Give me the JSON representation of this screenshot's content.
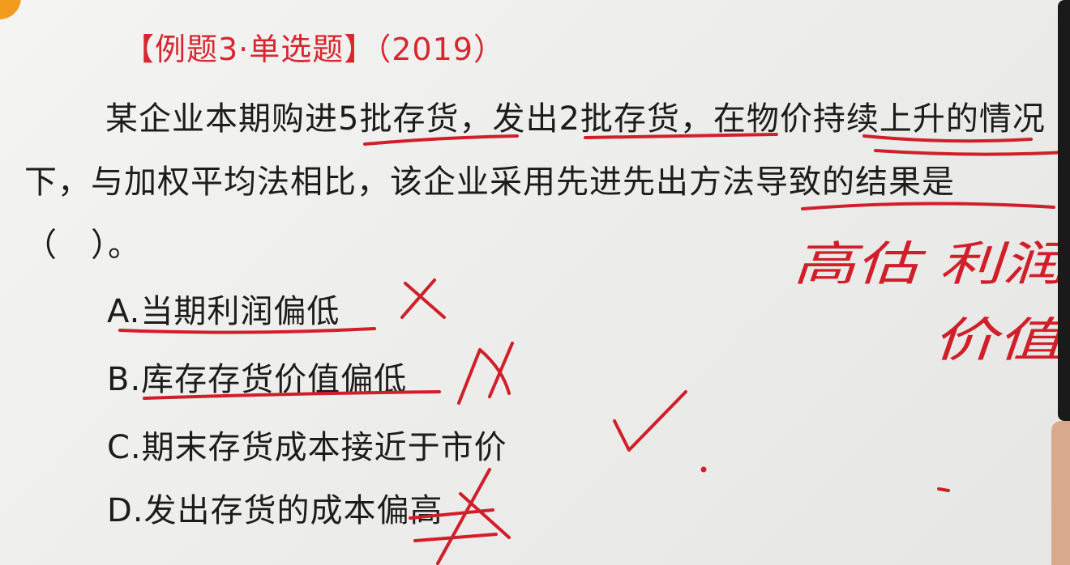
{
  "question": {
    "title": "【例题3·单选题】（2019）",
    "stem": "某企业本期购进5批存货，发出2批存货，在物价持续上升的情况下，与加权平均法相比，该企业采用先进先出方法导致的结果是（　）。",
    "options": [
      {
        "label": "A.当期利润偏低"
      },
      {
        "label": "B.库存存货价值偏低"
      },
      {
        "label": "C.期末存货成本接近于市价"
      },
      {
        "label": "D.发出存货的成本偏高"
      }
    ]
  },
  "handwriting": {
    "note_line_1": "高估 利润",
    "note_line_2": "价值"
  },
  "colors": {
    "title": "#d8262f",
    "body_text": "#1c1c1c",
    "ink": "#d11f2a",
    "badge": "#f39b1c"
  }
}
